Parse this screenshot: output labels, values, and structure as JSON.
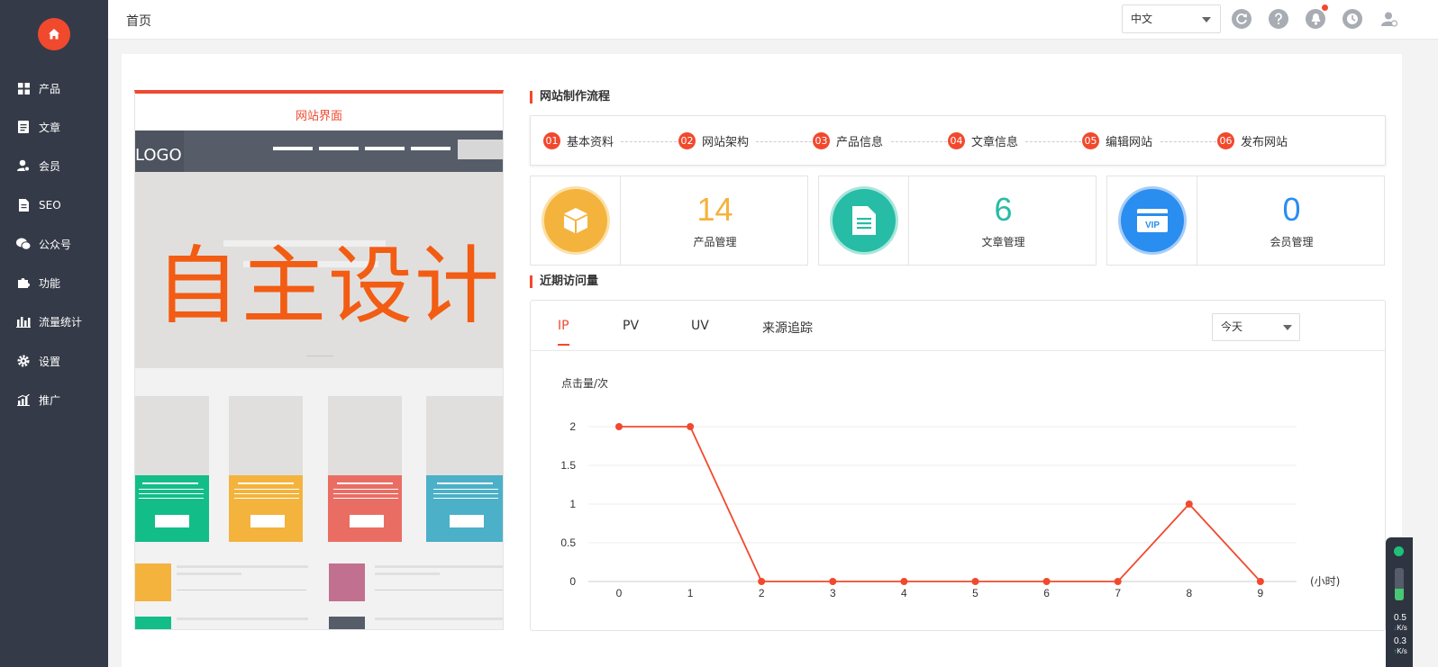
{
  "sidebar": {
    "items": [
      {
        "label": "产品",
        "icon": "grid-icon"
      },
      {
        "label": "文章",
        "icon": "document-icon"
      },
      {
        "label": "会员",
        "icon": "user-icon"
      },
      {
        "label": "SEO",
        "icon": "file-icon"
      },
      {
        "label": "公众号",
        "icon": "wechat-icon"
      },
      {
        "label": "功能",
        "icon": "puzzle-icon"
      },
      {
        "label": "流量统计",
        "icon": "bar-chart-icon"
      },
      {
        "label": "设置",
        "icon": "gear-icon"
      },
      {
        "label": "推广",
        "icon": "trend-icon"
      }
    ]
  },
  "header": {
    "title": "首页",
    "language": "中文"
  },
  "preview": {
    "title": "网站界面",
    "logo": "LOGO",
    "hero_text": "自主设计"
  },
  "process": {
    "title": "网站制作流程",
    "steps": [
      {
        "num": "01",
        "label": "基本资料"
      },
      {
        "num": "02",
        "label": "网站架构"
      },
      {
        "num": "03",
        "label": "产品信息"
      },
      {
        "num": "04",
        "label": "文章信息"
      },
      {
        "num": "05",
        "label": "编辑网站"
      },
      {
        "num": "06",
        "label": "发布网站"
      }
    ]
  },
  "stats": [
    {
      "value": "14",
      "label": "产品管理",
      "color": "#f4b33d",
      "icon": "box-icon"
    },
    {
      "value": "6",
      "label": "文章管理",
      "color": "#26bca5",
      "icon": "document-icon"
    },
    {
      "value": "0",
      "label": "会员管理",
      "color": "#2a8df0",
      "icon": "vip-icon"
    }
  ],
  "visits": {
    "title": "近期访问量",
    "tabs": [
      "IP",
      "PV",
      "UV",
      "来源追踪"
    ],
    "active_tab": "IP",
    "range": "今天"
  },
  "chart_data": {
    "type": "line",
    "ylabel": "点击量/次",
    "xlabel": "(小时)",
    "x": [
      0,
      1,
      2,
      3,
      4,
      5,
      6,
      7,
      8,
      9
    ],
    "values": [
      2,
      2,
      0,
      0,
      0,
      0,
      0,
      0,
      1,
      0
    ],
    "yticks": [
      "0",
      "0.5",
      "1",
      "1.5",
      "2"
    ],
    "ylim": [
      0,
      2
    ],
    "grid": true,
    "color": "#f1492e"
  },
  "net": {
    "down": "0.5",
    "up": "0.3",
    "unit": "K/s",
    "level": 0.35
  },
  "colors": {
    "accent": "#f1492e",
    "sidebar": "#353a48"
  }
}
